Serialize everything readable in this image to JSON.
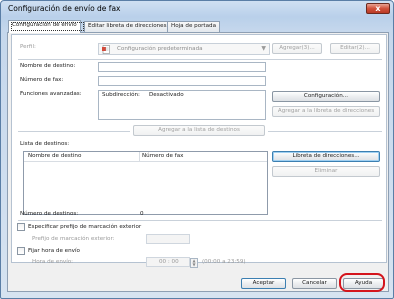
{
  "window": {
    "title": "Configuración de envío de fax",
    "close_glyph": "x"
  },
  "tabs": [
    {
      "label": "Configuración de envío",
      "active": true
    },
    {
      "label": "Editar libreta de direcciones",
      "active": false
    },
    {
      "label": "Hoja de portada",
      "active": false
    }
  ],
  "profile": {
    "label": "Perfil:",
    "value": "Configuración predeterminada",
    "add_label": "Agregar(3)...",
    "edit_label": "Editar(2)..."
  },
  "fields": {
    "destination_name_label": "Nombre de destino:",
    "fax_number_label": "Número de fax:",
    "advanced_functions_label": "Funciones avanzadas:",
    "subaddress_label": "Subdirección:",
    "subaddress_value": "Desactivado"
  },
  "buttons": {
    "configuration": "Configuración...",
    "add_to_addressbook": "Agregar a la libreta de direcciones",
    "add_to_destination_list": "Agregar a la lista de destinos",
    "address_book": "Libreta de direcciones...",
    "delete": "Eliminar",
    "accept": "Aceptar",
    "cancel": "Cancelar",
    "help": "Ayuda"
  },
  "destination_list": {
    "label": "Lista de destinos:",
    "columns": [
      "Nombre de destino",
      "Número de fax"
    ],
    "rows": []
  },
  "destination_count": {
    "label": "Número de destinos:",
    "value": "0"
  },
  "prefix": {
    "checkbox_label": "Especificar prefijo de marcación exterior",
    "prefix_field_label": "Prefijo de marcación exterior:",
    "checked": false
  },
  "send_time": {
    "checkbox_label": "Fijar hora de envío",
    "time_label": "Hora de envío:",
    "time_value": "00 : 00",
    "range_text": "(00:00 a 23:59)",
    "checked": false
  },
  "colors": {
    "highlight_ring": "#d4141c",
    "close_button": "#d1513b"
  }
}
